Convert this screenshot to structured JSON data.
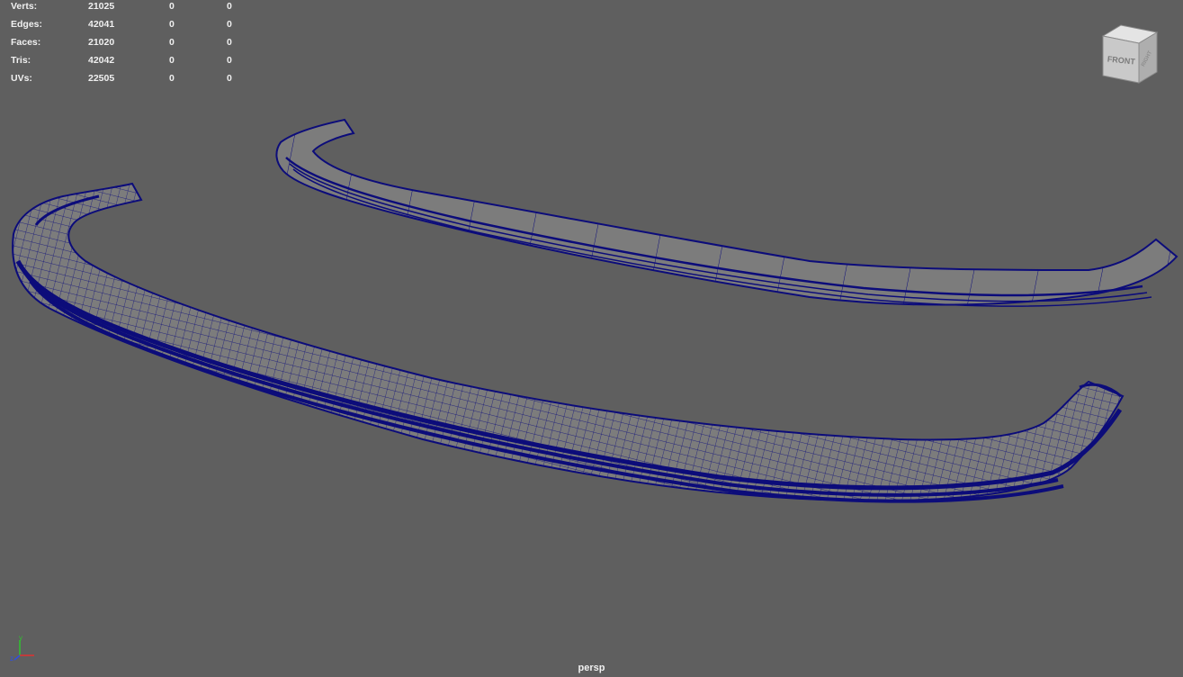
{
  "hud": {
    "rows": [
      {
        "label": "Verts:",
        "v1": "21025",
        "v2": "0",
        "v3": "0"
      },
      {
        "label": "Edges:",
        "v1": "42041",
        "v2": "0",
        "v3": "0"
      },
      {
        "label": "Faces:",
        "v1": "21020",
        "v2": "0",
        "v3": "0"
      },
      {
        "label": "Tris:",
        "v1": "42042",
        "v2": "0",
        "v3": "0"
      },
      {
        "label": "UVs:",
        "v1": "22505",
        "v2": "0",
        "v3": "0"
      }
    ]
  },
  "viewcube": {
    "front_label": "FRONT",
    "right_label": "RIGHT"
  },
  "axis": {
    "y_label": "y",
    "z_label": "z",
    "x_color": "#e03030",
    "y_color": "#30c030",
    "z_color": "#3050e0"
  },
  "viewport": {
    "camera_label": "persp",
    "background_color": "#5f5f5f",
    "wire_color": "#0c0c7a",
    "surface_color": "#7b7b7b"
  }
}
